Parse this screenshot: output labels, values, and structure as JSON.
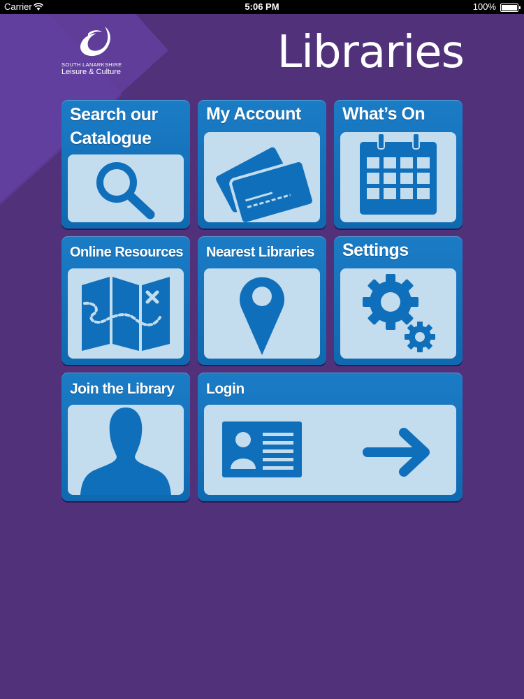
{
  "status_bar": {
    "carrier": "Carrier",
    "time": "5:06 PM",
    "battery": "100%"
  },
  "logo": {
    "line1": "SOUTH LANARKSHIRE",
    "line2": "Leisure & Culture"
  },
  "header": {
    "title": "Libraries"
  },
  "tiles": [
    {
      "label_line1": "Search our",
      "label_line2": "Catalogue",
      "icon": "magnifier-icon"
    },
    {
      "label": "My Account",
      "icon": "cards-icon"
    },
    {
      "label": "What’s On",
      "icon": "calendar-icon"
    },
    {
      "label": "Online Resources",
      "icon": "map-icon"
    },
    {
      "label": "Nearest Libraries",
      "icon": "map-pin-icon"
    },
    {
      "label": "Settings",
      "icon": "gears-icon"
    },
    {
      "label": "Join the Library",
      "icon": "person-silhouette-icon"
    },
    {
      "label": "Login",
      "icon": "id-card-arrow-icon"
    }
  ],
  "colors": {
    "background": "#50317a",
    "tile": "#1b7cc6",
    "panel": "#c3dcee",
    "icon": "#0f6fba"
  }
}
